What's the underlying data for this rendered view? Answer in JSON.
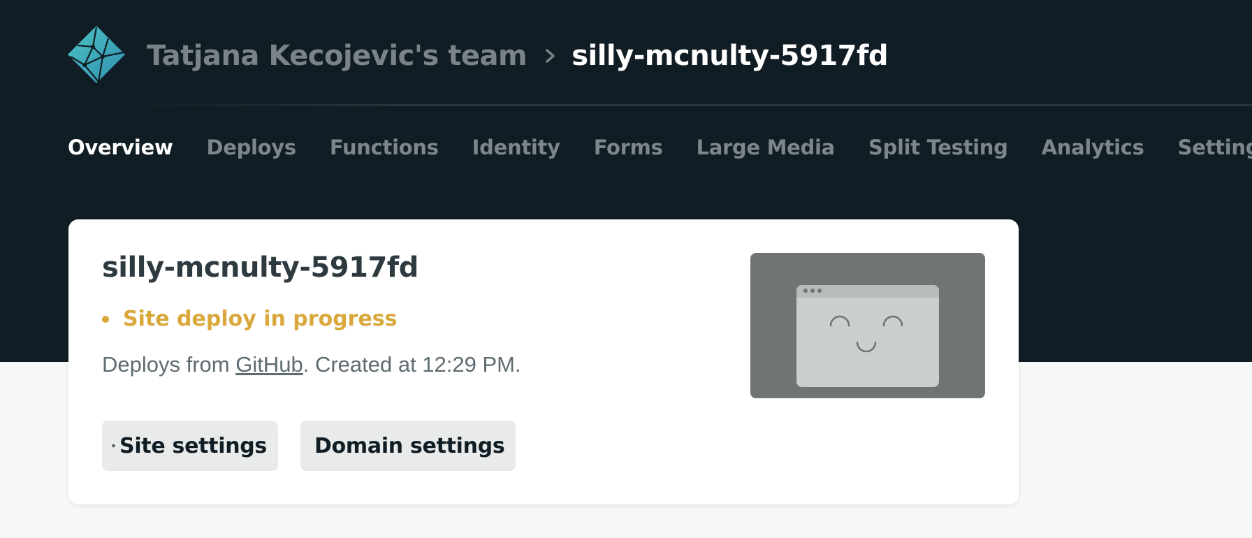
{
  "header": {
    "team_name": "Tatjana Kecojevic's team",
    "site_name": "silly-mcnulty-5917fd",
    "logo_icon": "netlify-logo-icon",
    "separator_icon": "chevron-right-icon"
  },
  "nav": {
    "tabs": [
      {
        "label": "Overview",
        "active": true
      },
      {
        "label": "Deploys"
      },
      {
        "label": "Functions"
      },
      {
        "label": "Identity"
      },
      {
        "label": "Forms"
      },
      {
        "label": "Large Media"
      },
      {
        "label": "Split Testing"
      },
      {
        "label": "Analytics"
      },
      {
        "label": "Settings"
      }
    ]
  },
  "site_card": {
    "title": "silly-mcnulty-5917fd",
    "status": "Site deploy in progress",
    "deploy_prefix": "Deploys from ",
    "deploy_link": "GitHub",
    "deploy_suffix": ". Created at 12:29 PM.",
    "buttons": {
      "site_settings": "Site settings",
      "domain_settings": "Domain settings"
    },
    "preview_icon": "browser-smiley-placeholder-icon"
  },
  "colors": {
    "header_bg": "#111d24",
    "page_bg": "#f6f8f8",
    "status_accent": "#d9a73a",
    "logo_teal": "#3fb4be"
  }
}
